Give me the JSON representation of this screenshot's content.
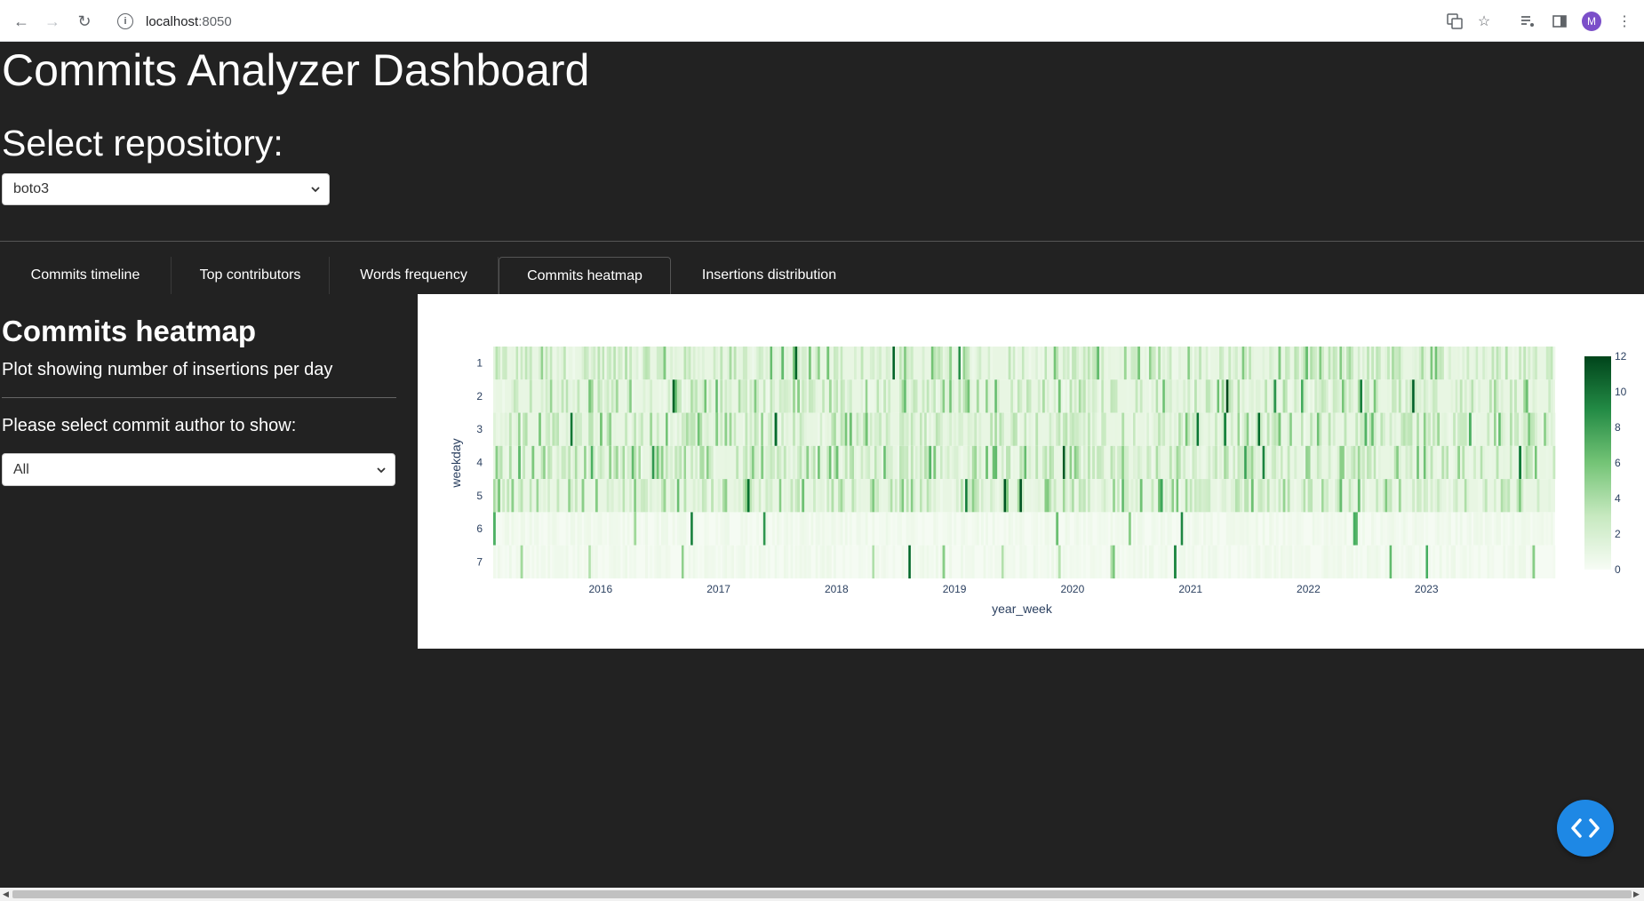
{
  "browser": {
    "url_host": "localhost",
    "url_port": ":8050",
    "avatar_initial": "M"
  },
  "page": {
    "title": "Commits Analyzer Dashboard",
    "repo_label": "Select repository:",
    "repo_value": "boto3"
  },
  "tabs": [
    {
      "label": "Commits timeline",
      "active": false
    },
    {
      "label": "Top contributors",
      "active": false
    },
    {
      "label": "Words frequency",
      "active": false
    },
    {
      "label": "Commits heatmap",
      "active": true
    },
    {
      "label": "Insertions distribution",
      "active": false
    }
  ],
  "panel": {
    "heading": "Commits heatmap",
    "subtitle": "Plot showing number of insertions per day",
    "author_label": "Please select commit author to show:",
    "author_value": "All"
  },
  "chart_data": {
    "type": "heatmap",
    "title": "",
    "xlabel": "year_week",
    "ylabel": "weekday",
    "x_tick_labels": [
      "2016",
      "2017",
      "2018",
      "2019",
      "2020",
      "2021",
      "2022",
      "2023"
    ],
    "y_categories": [
      "1",
      "2",
      "3",
      "4",
      "5",
      "6",
      "7"
    ],
    "x_range": [
      "2015-01",
      "2023-52"
    ],
    "colorscale": "Greens",
    "color_low": "#f7fcf5",
    "color_high": "#00441b",
    "colorbar": {
      "min": 0,
      "max": 12,
      "ticks": [
        "0",
        "2",
        "4",
        "6",
        "8",
        "10",
        "12"
      ]
    },
    "weekday_activity_level": [
      0.3,
      0.3,
      0.3,
      0.3,
      0.3,
      0.04,
      0.03
    ],
    "grid": false
  }
}
